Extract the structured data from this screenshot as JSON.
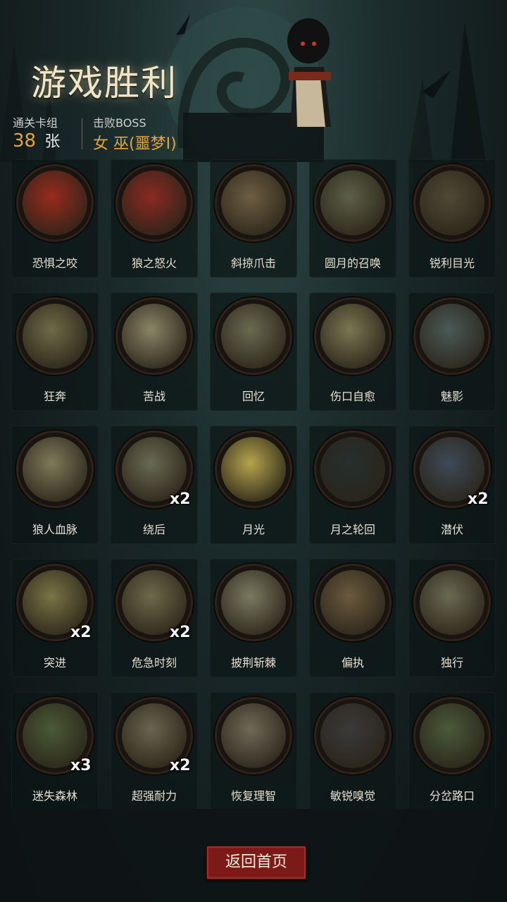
{
  "header": {
    "title": "游戏胜利",
    "deck_label": "通关卡组",
    "deck_count": "38",
    "deck_unit": "张",
    "boss_label": "击败BOSS",
    "boss_name": "女 巫(噩梦I)"
  },
  "cards": [
    {
      "label": "恐惧之咬",
      "badge": "",
      "icon": "demon-face-icon",
      "tone": "#9a2a1e"
    },
    {
      "label": "狼之怒火",
      "badge": "",
      "icon": "werewolf-fury-icon",
      "tone": "#8a2a22"
    },
    {
      "label": "斜掠爪击",
      "badge": "",
      "icon": "claw-strike-icon",
      "tone": "#6e5f43"
    },
    {
      "label": "圆月的召唤",
      "badge": "",
      "icon": "full-moon-icon",
      "tone": "#5d6048"
    },
    {
      "label": "锐利目光",
      "badge": "",
      "icon": "wolf-eyes-icon",
      "tone": "#4e4a36"
    },
    {
      "label": "狂奔",
      "badge": "",
      "icon": "running-wolf-icon",
      "tone": "#6f6a48"
    },
    {
      "label": "苦战",
      "badge": "",
      "icon": "struggle-icon",
      "tone": "#8a8468"
    },
    {
      "label": "回忆",
      "badge": "",
      "icon": "old-man-icon",
      "tone": "#6a6a50"
    },
    {
      "label": "伤口自愈",
      "badge": "",
      "icon": "healing-boy-icon",
      "tone": "#7a7652"
    },
    {
      "label": "魅影",
      "badge": "",
      "icon": "phantom-icon",
      "tone": "#4a5a58"
    },
    {
      "label": "狼人血脉",
      "badge": "",
      "icon": "werewolf-arm-icon",
      "tone": "#7e7a5a"
    },
    {
      "label": "绕后",
      "badge": "x2",
      "icon": "sneak-behind-icon",
      "tone": "#6a6a54"
    },
    {
      "label": "月光",
      "badge": "",
      "icon": "moonlight-icon",
      "tone": "#b5a44e"
    },
    {
      "label": "月之轮回",
      "badge": "",
      "icon": "moon-phases-icon",
      "tone": "#26302e"
    },
    {
      "label": "潜伏",
      "badge": "x2",
      "icon": "lurking-wolf-icon",
      "tone": "#3d4a58"
    },
    {
      "label": "突进",
      "badge": "x2",
      "icon": "dash-wolf-icon",
      "tone": "#7a7446"
    },
    {
      "label": "危急时刻",
      "badge": "x2",
      "icon": "critical-moment-icon",
      "tone": "#6c6a4c"
    },
    {
      "label": "披荆斩棘",
      "badge": "",
      "icon": "slash-thorns-icon",
      "tone": "#7a7a60"
    },
    {
      "label": "偏执",
      "badge": "",
      "icon": "bear-wolf-icon",
      "tone": "#6a5a3e"
    },
    {
      "label": "独行",
      "badge": "",
      "icon": "lone-walker-icon",
      "tone": "#6a6a52"
    },
    {
      "label": "迷失森林",
      "badge": "x3",
      "icon": "lost-forest-icon",
      "tone": "#4a5a36"
    },
    {
      "label": "超强耐力",
      "badge": "x2",
      "icon": "endurance-icon",
      "tone": "#6a6450"
    },
    {
      "label": "恢复理智",
      "badge": "",
      "icon": "sanity-icon",
      "tone": "#6e6a58"
    },
    {
      "label": "敏锐嗅觉",
      "badge": "",
      "icon": "keen-smell-icon",
      "tone": "#3a3a3a"
    },
    {
      "label": "分岔路口",
      "badge": "",
      "icon": "crossroads-icon",
      "tone": "#4a5a3a"
    }
  ],
  "footer": {
    "home_button": "返回首页"
  }
}
